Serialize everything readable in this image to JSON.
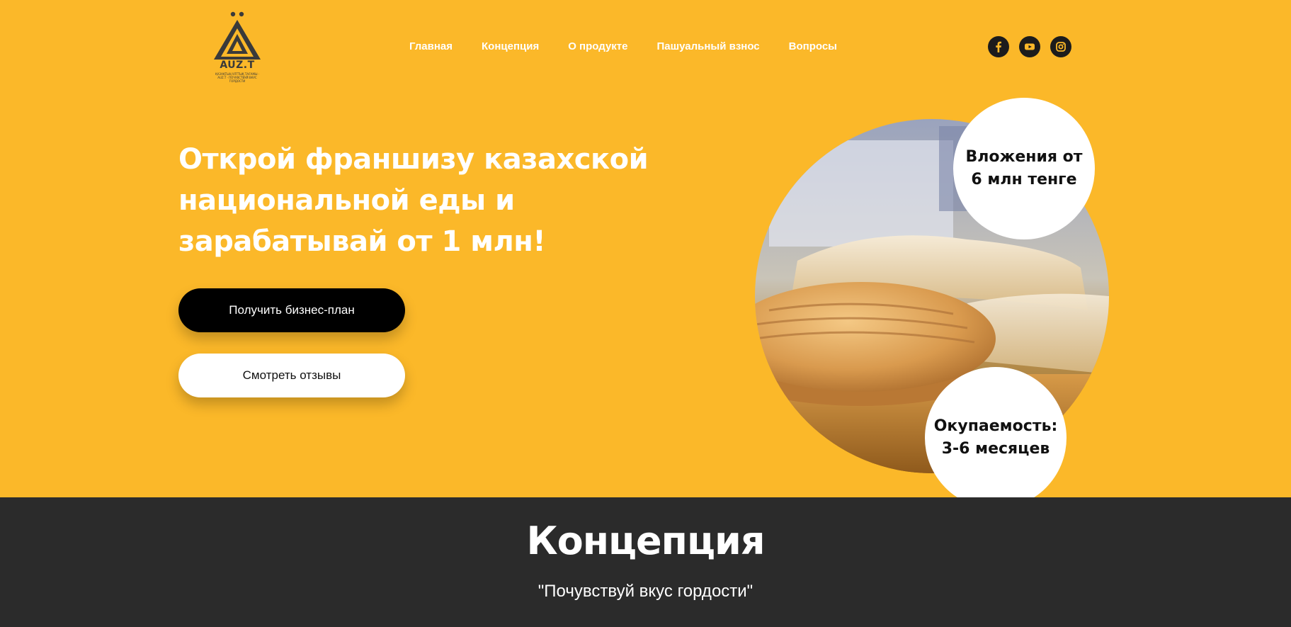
{
  "logo": {
    "name": "AUZ.T",
    "tagline": "ҚАЗАҚТЫҢ ҰЛТТЫҚ ТАҒАМЫ · AUZ.T · ПОЧУВСТВУЙ ВКУС ГОРДОСТИ"
  },
  "nav": {
    "items": [
      {
        "label": "Главная"
      },
      {
        "label": "Концепция"
      },
      {
        "label": "О продукте"
      },
      {
        "label": "Пашуальный взнос"
      },
      {
        "label": "Вопросы"
      }
    ]
  },
  "social": {
    "icons": [
      "facebook-icon",
      "youtube-icon",
      "instagram-icon"
    ]
  },
  "hero": {
    "headline_line1": "Открой франшизу казахской",
    "headline_line2": "национальной еды и",
    "headline_line3": "зарабатывай от 1 млн!",
    "primary_button": "Получить бизнес-план",
    "secondary_button": "Смотреть отзывы",
    "badge_top": "Вложения от 6 млн тенге",
    "badge_bottom": "Окупаемость: 3-6 месяцев"
  },
  "concept": {
    "title": "Концепция",
    "subtitle": "\"Почувствуй вкус гордости\""
  },
  "colors": {
    "accent": "#fbb829",
    "dark": "#2b2b2b",
    "button_dark": "#000000",
    "white": "#ffffff"
  }
}
